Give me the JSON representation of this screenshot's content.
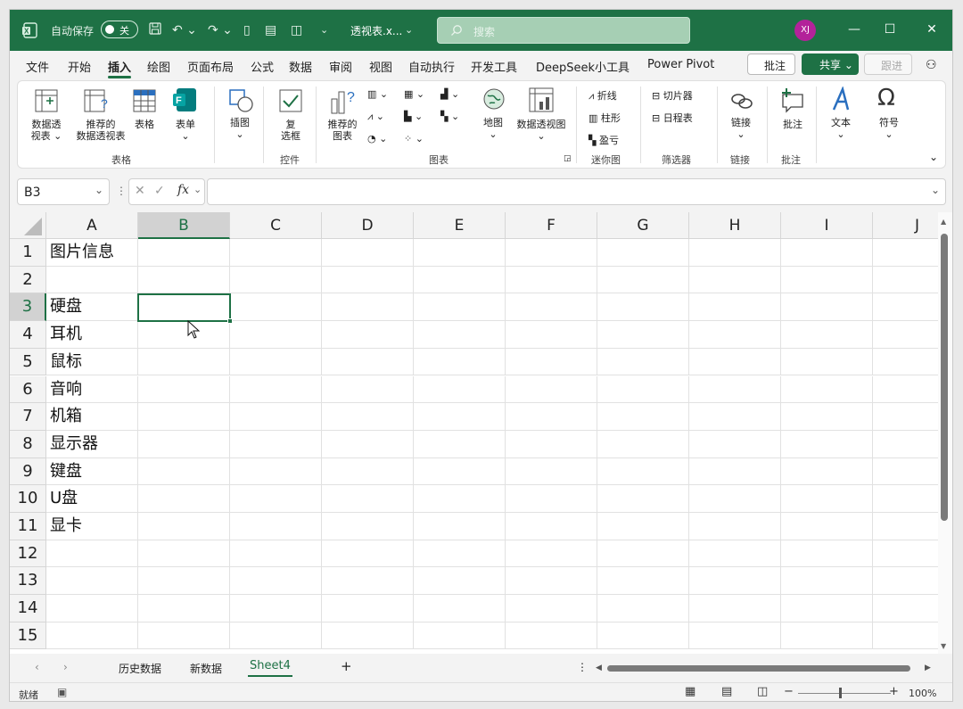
{
  "titlebar": {
    "autosave_label": "自动保存",
    "autosave_state": "关",
    "file_name": "透视表.x...",
    "search_placeholder": "搜索",
    "user_initials": "XJ"
  },
  "menu": {
    "items": [
      "文件",
      "开始",
      "插入",
      "绘图",
      "页面布局",
      "公式",
      "数据",
      "审阅",
      "视图",
      "自动执行",
      "开发工具",
      "DeepSeek小工具",
      "Power Pivot"
    ],
    "active": "插入",
    "comment_button": "批注",
    "share_button": "共享",
    "catchup_button": "跟进"
  },
  "ribbon": {
    "pivot_table": "数据透\n视表",
    "recommended_pivot": "推荐的\n数据透视表",
    "table": "表格",
    "forms": "表单",
    "illustrations": "插图",
    "checkbox": "复\n选框",
    "recommended_charts": "推荐的\n图表",
    "maps": "地图",
    "pivot_chart": "数据透视图",
    "spark_line": "折线",
    "spark_column": "柱形",
    "spark_winloss": "盈亏",
    "slicer": "切片器",
    "timeline": "日程表",
    "link": "链接",
    "comment": "批注",
    "text": "文本",
    "symbol": "符号",
    "groups": {
      "tables": "表格",
      "controls": "控件",
      "charts": "图表",
      "sparklines": "迷你图",
      "filters": "筛选器",
      "links": "链接",
      "comments": "批注"
    }
  },
  "formula_bar": {
    "name_box": "B3",
    "fx_label": "fx",
    "formula": ""
  },
  "grid": {
    "columns": [
      "A",
      "B",
      "C",
      "D",
      "E",
      "F",
      "G",
      "H",
      "I",
      "J"
    ],
    "selected_column": "B",
    "selected_row": "3",
    "rows": [
      "1",
      "2",
      "3",
      "4",
      "5",
      "6",
      "7",
      "8",
      "9",
      "10",
      "11",
      "12",
      "13",
      "14",
      "15"
    ],
    "col_a_values": [
      "图片信息",
      "",
      "硬盘",
      "耳机",
      "鼠标",
      "音响",
      "机箱",
      "显示器",
      "键盘",
      "U盘",
      "显卡",
      "",
      "",
      "",
      ""
    ]
  },
  "sheets": {
    "tabs": [
      "历史数据",
      "新数据",
      "Sheet4"
    ],
    "active": "Sheet4",
    "add_label": "+"
  },
  "status": {
    "ready": "就绪",
    "zoom": "100%"
  },
  "colors": {
    "accent": "#1e7145",
    "avatar": "#b3229a"
  }
}
